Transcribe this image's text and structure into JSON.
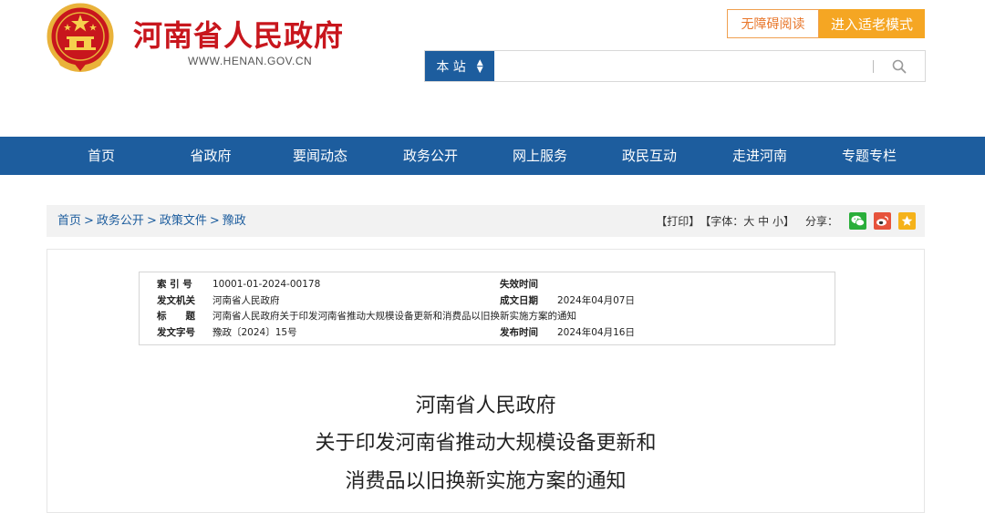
{
  "header": {
    "title": "河南省人民政府",
    "url": "WWW.HENAN.GOV.CN",
    "accessibility_label": "无障碍阅读",
    "elder_mode_label": "进入适老模式"
  },
  "search": {
    "scope": "本 站",
    "value": ""
  },
  "nav": {
    "items": [
      "首页",
      "省政府",
      "要闻动态",
      "政务公开",
      "网上服务",
      "政民互动",
      "走进河南",
      "专题专栏"
    ]
  },
  "breadcrumb": {
    "items": [
      "首页",
      "政务公开",
      "政策文件",
      "豫政"
    ],
    "separator": ">"
  },
  "tools": {
    "print": "【打印】",
    "font_prefix": "【字体：",
    "font_large": "大",
    "font_medium": "中",
    "font_small": "小",
    "font_suffix": "】",
    "share_label": "分享："
  },
  "meta": {
    "index_label": "索 引 号",
    "index_value": "10001-01-2024-00178",
    "expire_label": "失效时间",
    "expire_value": "",
    "issuer_label": "发文机关",
    "issuer_value": "河南省人民政府",
    "written_label": "成文日期",
    "written_value": "2024年04月07日",
    "title_label": "标　　题",
    "title_value": "河南省人民政府关于印发河南省推动大规模设备更新和消费品以旧换新实施方案的通知",
    "docno_label": "发文字号",
    "docno_value": "豫政〔2024〕15号",
    "publish_label": "发布时间",
    "publish_value": "2024年04月16日"
  },
  "document": {
    "title_line1": "河南省人民政府",
    "title_line2": "关于印发河南省推动大规模设备更新和",
    "title_line3": "消费品以旧换新实施方案的通知"
  },
  "colors": {
    "brand_red": "#c8161d",
    "nav_blue": "#1d5d9e",
    "orange": "#f5a623",
    "wechat_green": "#2aae3a",
    "weibo_red": "#e6533c",
    "favorite_yellow": "#f5b21a"
  },
  "icons": [
    "national-emblem-icon",
    "search-icon",
    "wechat-icon",
    "weibo-icon",
    "star-icon"
  ]
}
